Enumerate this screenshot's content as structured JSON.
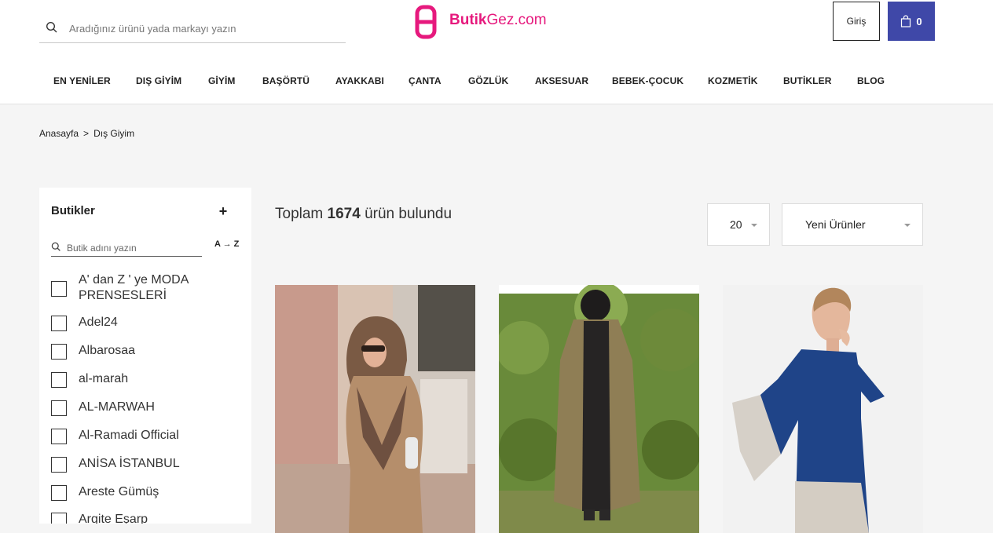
{
  "search": {
    "placeholder": "Aradığınız ürünü yada markayı yazın"
  },
  "logo": {
    "brand_bold": "Butik",
    "brand_light": "Gez",
    "brand_tld": ".com"
  },
  "header": {
    "login_label": "Giriş",
    "cart_count": "0"
  },
  "nav": [
    "EN YENİLER",
    "DIŞ GİYİM",
    "GİYİM",
    "BAŞÖRTÜ",
    "AYAKKABI",
    "ÇANTA",
    "GÖZLÜK",
    "AKSESUAR",
    "BEBEK-ÇOCUK",
    "KOZMETİK",
    "BUTİKLER",
    "BLOG"
  ],
  "breadcrumb": {
    "home": "Anasayfa",
    "separator": ">",
    "current": "Dış Giyim"
  },
  "sidebar": {
    "title": "Butikler",
    "expand_symbol": "+",
    "search_placeholder": "Butik adını yazın",
    "sort_label": "A → Z",
    "items": [
      "A' dan Z ' ye MODA PRENSESLERİ",
      "Adel24",
      "Albarosaa",
      "al-marah",
      "AL-MARWAH",
      "Al-Ramadi Official",
      "ANİSA İSTANBUL",
      "Areste Gümüş",
      "Argite Eşarp"
    ]
  },
  "results": {
    "prefix": "Toplam",
    "count": "1674",
    "suffix": "ürün bulundu"
  },
  "page_size": {
    "value": "20"
  },
  "sort_select": {
    "value": "Yeni Ürünler"
  },
  "colors": {
    "brand_pink": "#e6197d",
    "cart_blue": "#3f48a8"
  }
}
